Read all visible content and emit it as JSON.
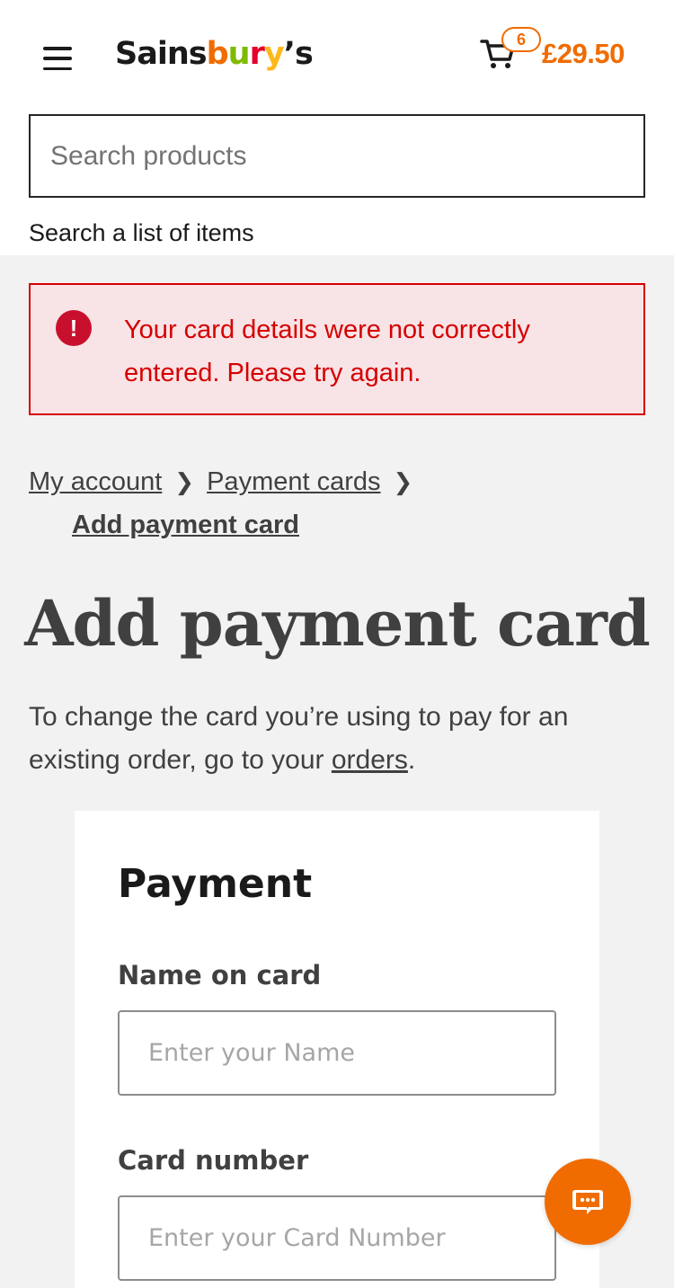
{
  "header": {
    "logo_parts": [
      "Sainsbury's"
    ],
    "basket_count": "6",
    "basket_total": "£29.50"
  },
  "search": {
    "placeholder": "Search products",
    "list_link": "Search a list of items"
  },
  "alert": {
    "message": "Your card details were not correctly entered. Please try again.",
    "icon": "exclamation-icon"
  },
  "breadcrumb": {
    "items": [
      "My account",
      "Payment cards"
    ],
    "current": "Add payment card"
  },
  "page": {
    "title": "Add payment card",
    "intro_text": "To change the card you’re using to pay for an existing order, go to your ",
    "intro_link": "orders",
    "intro_end": "."
  },
  "payment_form": {
    "title": "Payment",
    "name_label": "Name on card",
    "name_placeholder": "Enter your Name",
    "card_label": "Card number",
    "card_placeholder": "Enter your Card Number"
  },
  "colors": {
    "brand_orange": "#f06c00",
    "error_red": "#d50000",
    "error_bg": "#f8e3e6"
  }
}
